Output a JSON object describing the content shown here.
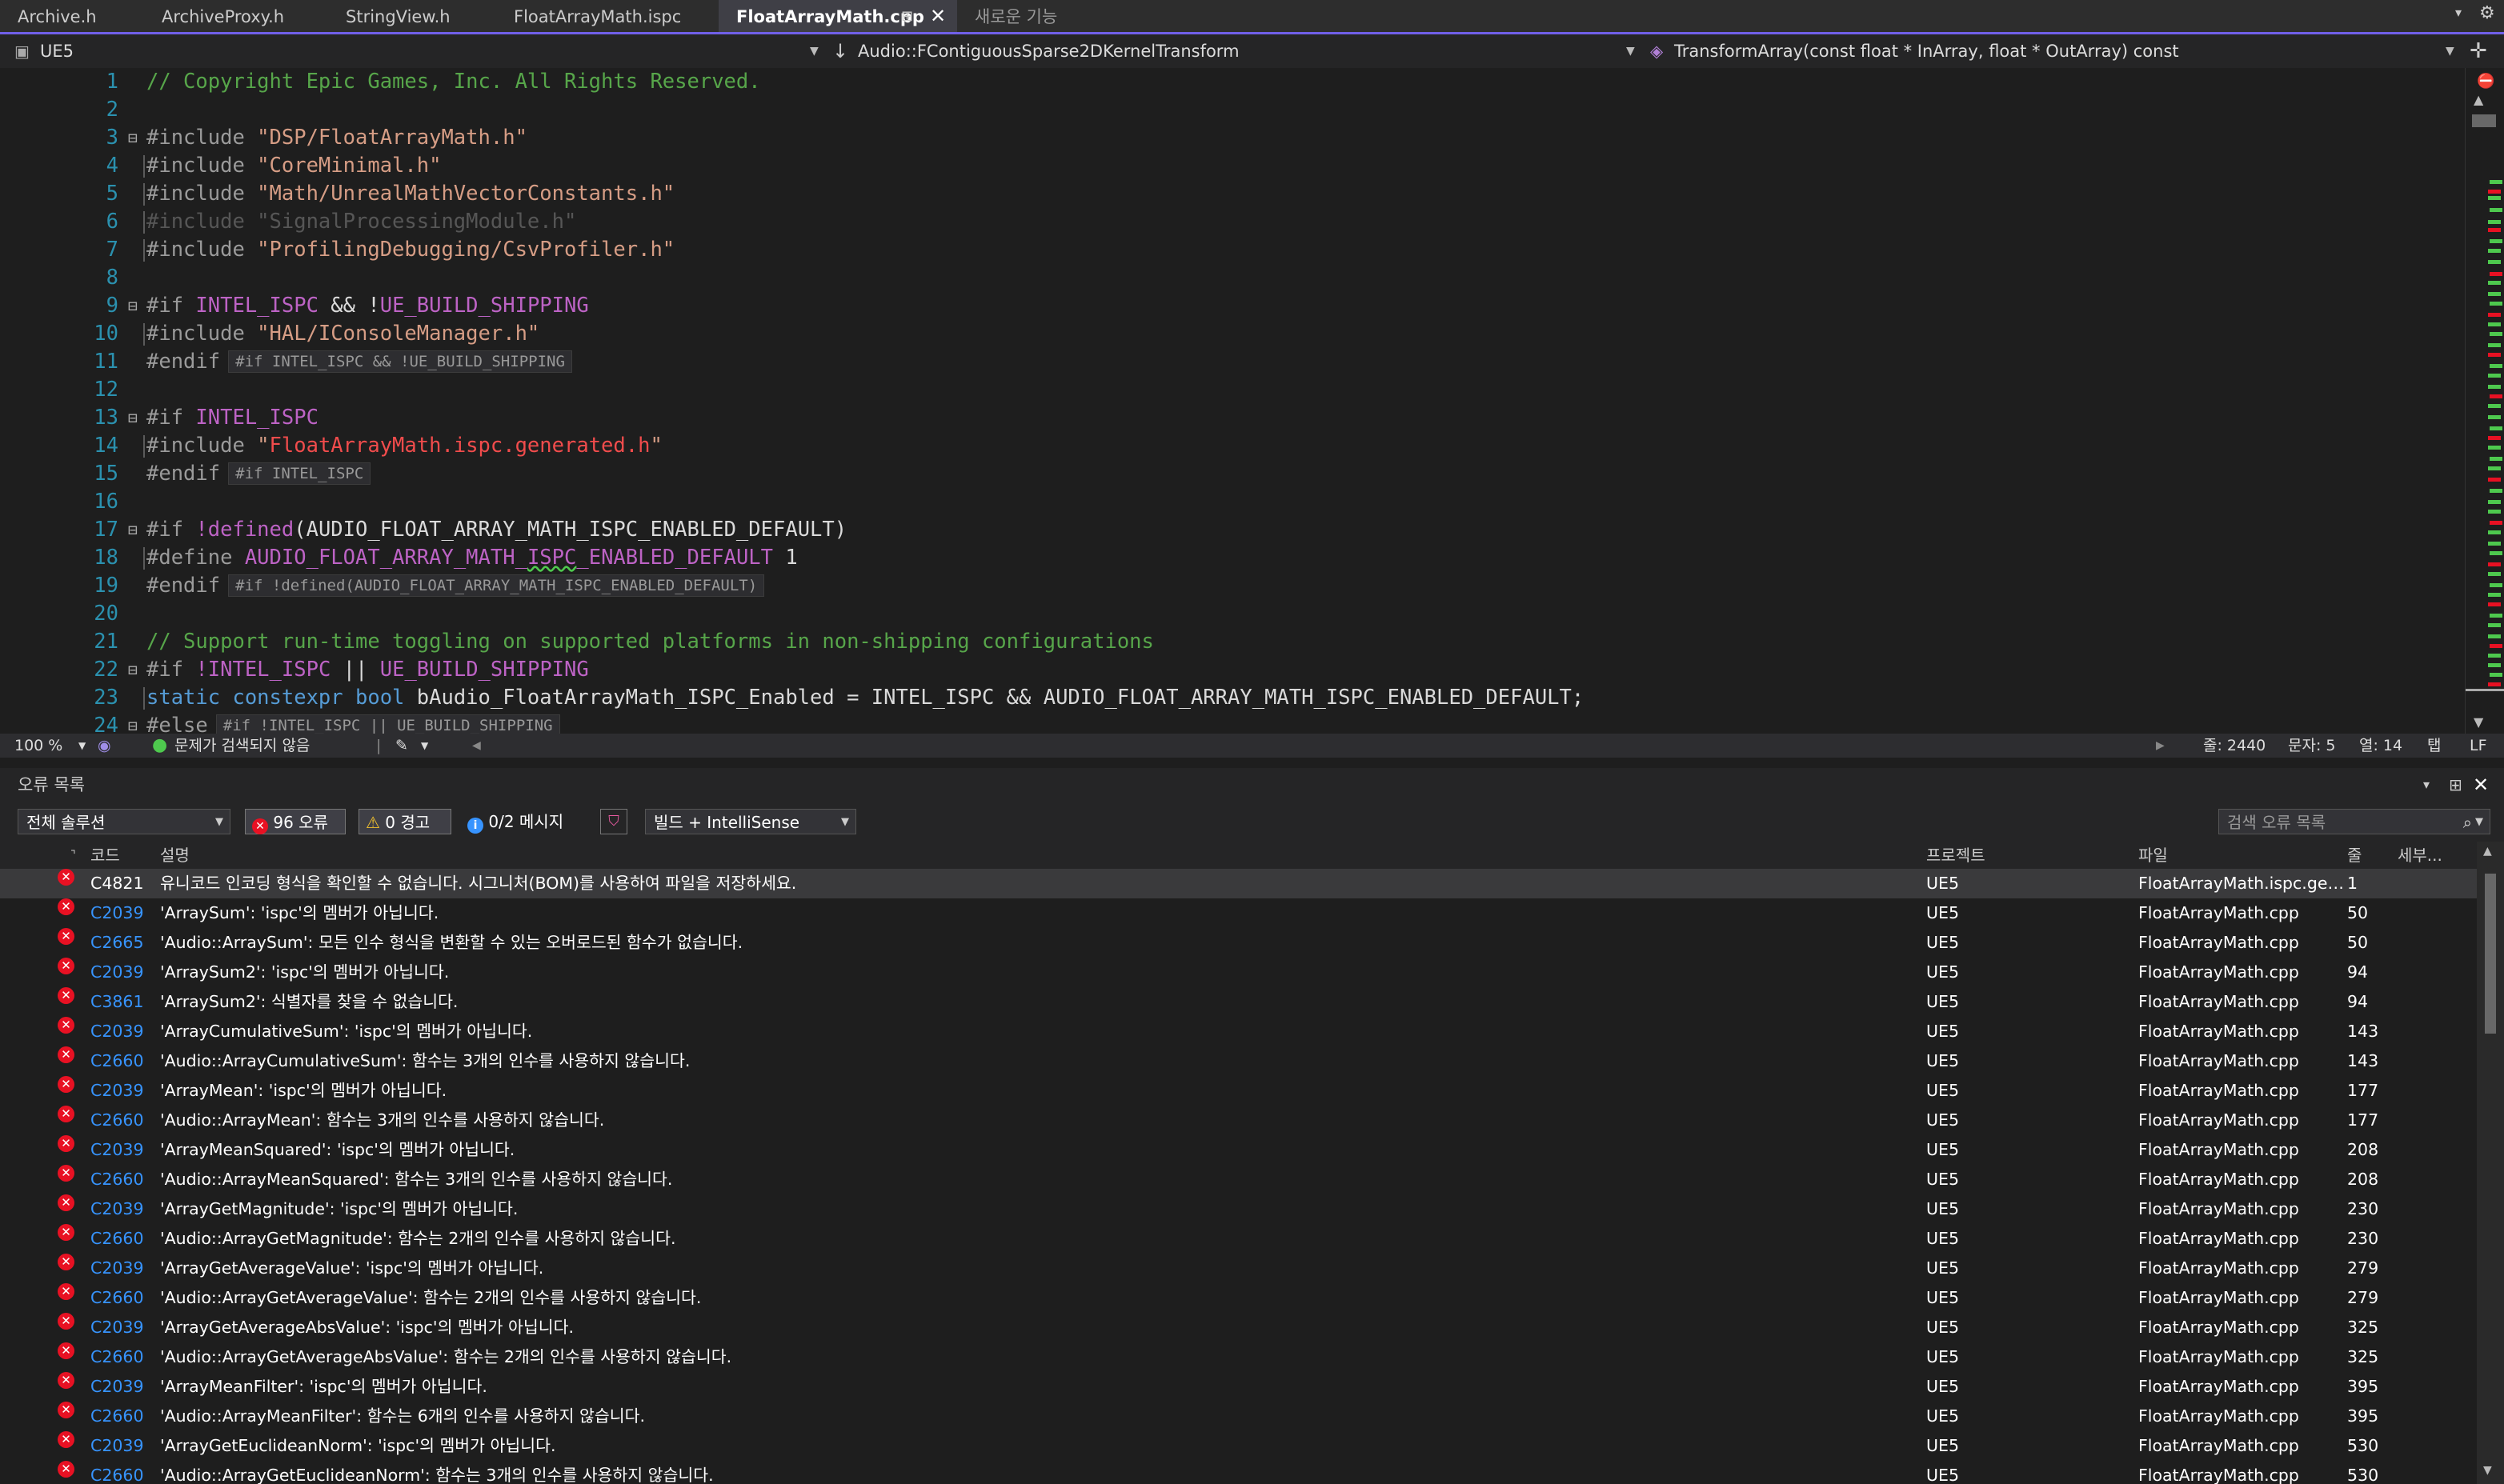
{
  "tabs": [
    {
      "label": "Archive.h"
    },
    {
      "label": "ArchiveProxy.h"
    },
    {
      "label": "StringView.h"
    },
    {
      "label": "FloatArrayMath.ispc"
    },
    {
      "label": "FloatArrayMath.cpp"
    },
    {
      "label": "새로운 기능"
    }
  ],
  "icons": {
    "pin": "pin-icon",
    "close": "close-icon",
    "error": "error-circle-icon",
    "warning": "warning-triangle-icon",
    "info": "info-icon",
    "filter": "filter-icon",
    "search": "search-icon",
    "ok": "check-circle-icon",
    "gear": "gear-icon"
  },
  "nav": {
    "project": "UE5",
    "scope": "Audio::FContiguousSparse2DKernelTransform",
    "member": "TransformArray(const float * InArray, float * OutArray) const"
  },
  "code_lines": [
    {
      "n": "1",
      "tokens": [
        {
          "t": "// Copyright Epic Games, Inc. All Rights Reserved.",
          "c": "com"
        }
      ]
    },
    {
      "n": "2",
      "tokens": []
    },
    {
      "n": "3",
      "fold": "⊟",
      "tokens": [
        {
          "t": "#include ",
          "c": "pp"
        },
        {
          "t": "\"DSP/FloatArrayMath.h\"",
          "c": "str"
        }
      ]
    },
    {
      "n": "4",
      "guide": true,
      "tokens": [
        {
          "t": "#include ",
          "c": "pp"
        },
        {
          "t": "\"CoreMinimal.h\"",
          "c": "str"
        }
      ]
    },
    {
      "n": "5",
      "guide": true,
      "tokens": [
        {
          "t": "#include ",
          "c": "pp"
        },
        {
          "t": "\"Math/UnrealMathVectorConstants.h\"",
          "c": "str"
        }
      ]
    },
    {
      "n": "6",
      "guide": true,
      "tokens": [
        {
          "t": "#include \"SignalProcessingModule.h\"",
          "c": "pp dim"
        }
      ]
    },
    {
      "n": "7",
      "guide": true,
      "tokens": [
        {
          "t": "#include ",
          "c": "pp"
        },
        {
          "t": "\"ProfilingDebugging/CsvProfiler.h\"",
          "c": "str"
        }
      ]
    },
    {
      "n": "8",
      "tokens": []
    },
    {
      "n": "9",
      "fold": "⊟",
      "tokens": [
        {
          "t": "#if ",
          "c": "pp"
        },
        {
          "t": "INTEL_ISPC",
          "c": "mac"
        },
        {
          "t": " && !",
          "c": "id"
        },
        {
          "t": "UE_BUILD_SHIPPING",
          "c": "mac"
        }
      ]
    },
    {
      "n": "10",
      "guide": true,
      "tokens": [
        {
          "t": "#include ",
          "c": "pp"
        },
        {
          "t": "\"HAL/IConsoleManager.h\"",
          "c": "str"
        }
      ]
    },
    {
      "n": "11",
      "tokens": [
        {
          "t": "#endif",
          "c": "pp"
        }
      ],
      "hint": "#if INTEL_ISPC && !UE_BUILD_SHIPPING"
    },
    {
      "n": "12",
      "tokens": []
    },
    {
      "n": "13",
      "fold": "⊟",
      "tokens": [
        {
          "t": "#if ",
          "c": "pp"
        },
        {
          "t": "INTEL_ISPC",
          "c": "mac"
        }
      ]
    },
    {
      "n": "14",
      "guide": true,
      "tokens": [
        {
          "t": "#include ",
          "c": "pp"
        },
        {
          "t": "\"",
          "c": "str"
        },
        {
          "t": "FloatArrayMath.ispc.generated.h",
          "c": "str",
          "style": "color:#f14c4c"
        },
        {
          "t": "\"",
          "c": "str"
        }
      ]
    },
    {
      "n": "15",
      "tokens": [
        {
          "t": "#endif",
          "c": "pp"
        }
      ],
      "hint": "#if INTEL_ISPC"
    },
    {
      "n": "16",
      "tokens": []
    },
    {
      "n": "17",
      "fold": "⊟",
      "tokens": [
        {
          "t": "#if ",
          "c": "pp"
        },
        {
          "t": "!defined",
          "c": "mac"
        },
        {
          "t": "(AUDIO_FLOAT_ARRAY_MATH_ISPC_ENABLED_DEFAULT)",
          "c": "id"
        }
      ]
    },
    {
      "n": "18",
      "guide": true,
      "tokens": [
        {
          "t": "#define ",
          "c": "pp"
        },
        {
          "t": "AUDIO_FLOAT_ARRAY_MATH_",
          "c": "mac"
        },
        {
          "t": "ISPC",
          "c": "mac squig"
        },
        {
          "t": "_ENABLED_DEFAULT",
          "c": "mac"
        },
        {
          "t": " 1",
          "c": "id"
        }
      ]
    },
    {
      "n": "19",
      "tokens": [
        {
          "t": "#endif",
          "c": "pp"
        }
      ],
      "hint": "#if !defined(AUDIO_FLOAT_ARRAY_MATH_ISPC_ENABLED_DEFAULT)"
    },
    {
      "n": "20",
      "tokens": []
    },
    {
      "n": "21",
      "tokens": [
        {
          "t": "// Support run-time toggling on supported platforms in non-shipping configurations",
          "c": "com"
        }
      ]
    },
    {
      "n": "22",
      "fold": "⊟",
      "tokens": [
        {
          "t": "#if ",
          "c": "pp"
        },
        {
          "t": "!INTEL_ISPC",
          "c": "mac"
        },
        {
          "t": " || ",
          "c": "id"
        },
        {
          "t": "UE_BUILD_SHIPPING",
          "c": "mac"
        }
      ]
    },
    {
      "n": "23",
      "guide": true,
      "tokens": [
        {
          "t": "static constexpr bool",
          "c": "kw"
        },
        {
          "t": " bAudio_FloatArrayMath_ISPC_Enabled = INTEL_ISPC && AUDIO_FLOAT_ARRAY_MATH_ISPC_ENABLED_DEFAULT;",
          "c": "id"
        }
      ]
    },
    {
      "n": "24",
      "fold": "⊟",
      "tokens": [
        {
          "t": "#else",
          "c": "pp"
        }
      ],
      "hint": "#if !INTEL_ISPC || UE_BUILD_SHIPPING"
    }
  ],
  "editor_status": {
    "zoom": "100 %",
    "issues": "문제가 검색되지 않음",
    "line": "줄: 2440",
    "char": "문자: 5",
    "col": "열: 14",
    "indent": "탭",
    "eol": "LF"
  },
  "error_panel": {
    "title": "오류 목록",
    "scope": "전체 솔루션",
    "errors_btn": "96 오류",
    "warnings_btn": "0 경고",
    "messages_btn": "0/2 메시지",
    "build_filter": "빌드 + IntelliSense",
    "search_placeholder": "검색 오류 목록",
    "columns": {
      "code": "코드",
      "desc": "설명",
      "project": "프로젝트",
      "file": "파일",
      "line": "줄",
      "detail": "세부..."
    },
    "rows": [
      {
        "code": "C4821",
        "desc": "유니코드 인코딩 형식을 확인할 수 없습니다. 시그니처(BOM)를 사용하여 파일을 저장하세요.",
        "project": "UE5",
        "file": "FloatArrayMath.ispc.generated.h",
        "line": "1"
      },
      {
        "code": "C2039",
        "desc": "'ArraySum': 'ispc'의 멤버가 아닙니다.",
        "project": "UE5",
        "file": "FloatArrayMath.cpp",
        "line": "50"
      },
      {
        "code": "C2665",
        "desc": "'Audio::ArraySum': 모든 인수 형식을 변환할 수 있는 오버로드된 함수가 없습니다.",
        "project": "UE5",
        "file": "FloatArrayMath.cpp",
        "line": "50"
      },
      {
        "code": "C2039",
        "desc": "'ArraySum2': 'ispc'의 멤버가 아닙니다.",
        "project": "UE5",
        "file": "FloatArrayMath.cpp",
        "line": "94"
      },
      {
        "code": "C3861",
        "desc": "'ArraySum2': 식별자를 찾을 수 없습니다.",
        "project": "UE5",
        "file": "FloatArrayMath.cpp",
        "line": "94"
      },
      {
        "code": "C2039",
        "desc": "'ArrayCumulativeSum': 'ispc'의 멤버가 아닙니다.",
        "project": "UE5",
        "file": "FloatArrayMath.cpp",
        "line": "143"
      },
      {
        "code": "C2660",
        "desc": "'Audio::ArrayCumulativeSum': 함수는 3개의 인수를 사용하지 않습니다.",
        "project": "UE5",
        "file": "FloatArrayMath.cpp",
        "line": "143"
      },
      {
        "code": "C2039",
        "desc": "'ArrayMean': 'ispc'의 멤버가 아닙니다.",
        "project": "UE5",
        "file": "FloatArrayMath.cpp",
        "line": "177"
      },
      {
        "code": "C2660",
        "desc": "'Audio::ArrayMean': 함수는 3개의 인수를 사용하지 않습니다.",
        "project": "UE5",
        "file": "FloatArrayMath.cpp",
        "line": "177"
      },
      {
        "code": "C2039",
        "desc": "'ArrayMeanSquared': 'ispc'의 멤버가 아닙니다.",
        "project": "UE5",
        "file": "FloatArrayMath.cpp",
        "line": "208"
      },
      {
        "code": "C2660",
        "desc": "'Audio::ArrayMeanSquared': 함수는 3개의 인수를 사용하지 않습니다.",
        "project": "UE5",
        "file": "FloatArrayMath.cpp",
        "line": "208"
      },
      {
        "code": "C2039",
        "desc": "'ArrayGetMagnitude': 'ispc'의 멤버가 아닙니다.",
        "project": "UE5",
        "file": "FloatArrayMath.cpp",
        "line": "230"
      },
      {
        "code": "C2660",
        "desc": "'Audio::ArrayGetMagnitude': 함수는 2개의 인수를 사용하지 않습니다.",
        "project": "UE5",
        "file": "FloatArrayMath.cpp",
        "line": "230"
      },
      {
        "code": "C2039",
        "desc": "'ArrayGetAverageValue': 'ispc'의 멤버가 아닙니다.",
        "project": "UE5",
        "file": "FloatArrayMath.cpp",
        "line": "279"
      },
      {
        "code": "C2660",
        "desc": "'Audio::ArrayGetAverageValue': 함수는 2개의 인수를 사용하지 않습니다.",
        "project": "UE5",
        "file": "FloatArrayMath.cpp",
        "line": "279"
      },
      {
        "code": "C2039",
        "desc": "'ArrayGetAverageAbsValue': 'ispc'의 멤버가 아닙니다.",
        "project": "UE5",
        "file": "FloatArrayMath.cpp",
        "line": "325"
      },
      {
        "code": "C2660",
        "desc": "'Audio::ArrayGetAverageAbsValue': 함수는 2개의 인수를 사용하지 않습니다.",
        "project": "UE5",
        "file": "FloatArrayMath.cpp",
        "line": "325"
      },
      {
        "code": "C2039",
        "desc": "'ArrayMeanFilter': 'ispc'의 멤버가 아닙니다.",
        "project": "UE5",
        "file": "FloatArrayMath.cpp",
        "line": "395"
      },
      {
        "code": "C2660",
        "desc": "'Audio::ArrayMeanFilter': 함수는 6개의 인수를 사용하지 않습니다.",
        "project": "UE5",
        "file": "FloatArrayMath.cpp",
        "line": "395"
      },
      {
        "code": "C2039",
        "desc": "'ArrayGetEuclideanNorm': 'ispc'의 멤버가 아닙니다.",
        "project": "UE5",
        "file": "FloatArrayMath.cpp",
        "line": "530"
      },
      {
        "code": "C2660",
        "desc": "'Audio::ArrayGetEuclideanNorm': 함수는 3개의 인수를 사용하지 않습니다.",
        "project": "UE5",
        "file": "FloatArrayMath.cpp",
        "line": "530"
      }
    ]
  },
  "colors": {
    "accent": "#7160e8",
    "error": "#e81123",
    "error_code": "#3794ff",
    "warning": "#f2c12e",
    "info": "#3794ff"
  }
}
